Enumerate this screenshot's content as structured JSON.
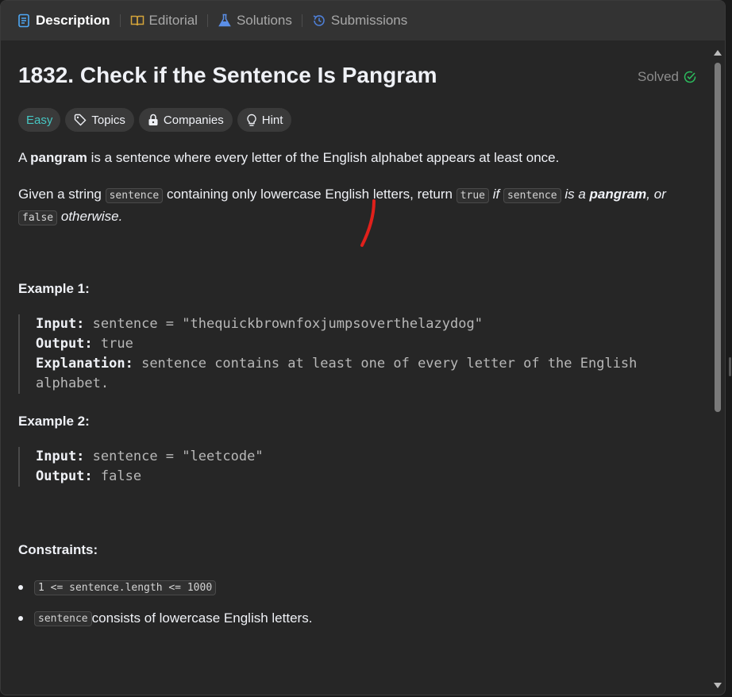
{
  "tabs": [
    {
      "label": "Description",
      "icon": "description-icon",
      "active": true
    },
    {
      "label": "Editorial",
      "icon": "book-icon"
    },
    {
      "label": "Solutions",
      "icon": "flask-icon"
    },
    {
      "label": "Submissions",
      "icon": "history-icon"
    }
  ],
  "problem": {
    "title": "1832. Check if the Sentence Is Pangram",
    "status": "Solved"
  },
  "chips": [
    {
      "label": "Easy"
    },
    {
      "label": "Topics",
      "icon": "tag-icon"
    },
    {
      "label": "Companies",
      "icon": "lock-icon"
    },
    {
      "label": "Hint",
      "icon": "lightbulb-icon"
    }
  ],
  "description": {
    "p1": {
      "a": "A ",
      "bold": "pangram",
      "b": " is a sentence where every letter of the English alphabet appears at least once."
    },
    "p2": {
      "a": "Given a string ",
      "code1": "sentence",
      "b": " containing only lowercase English letters, return ",
      "code2": "true",
      "c": " if ",
      "code3": "sentence",
      "d": " is a ",
      "bold": "pangram",
      "e": ", or",
      "code4": "false",
      "f": " otherwise."
    }
  },
  "examples": [
    {
      "heading": "Example 1:",
      "input_label": "Input:",
      "input": "sentence = \"thequickbrownfoxjumpsoverthelazydog\"",
      "output_label": "Output:",
      "output": "true",
      "explanation_label": "Explanation:",
      "explanation_1": "sentence contains at least one of every letter of the English",
      "explanation_2": "alphabet."
    },
    {
      "heading": "Example 2:",
      "input_label": "Input:",
      "input": "sentence = \"leetcode\"",
      "output_label": "Output:",
      "output": "false"
    }
  ],
  "constraints": {
    "heading": "Constraints:",
    "items": [
      {
        "code": "1 <= sentence.length <= 1000",
        "text": ""
      },
      {
        "code": "sentence",
        "text": " consists of lowercase English letters."
      }
    ]
  },
  "colors": {
    "accent": "#46c6c2",
    "solved": "#2cbb5d",
    "annotation": "#e0201b"
  }
}
